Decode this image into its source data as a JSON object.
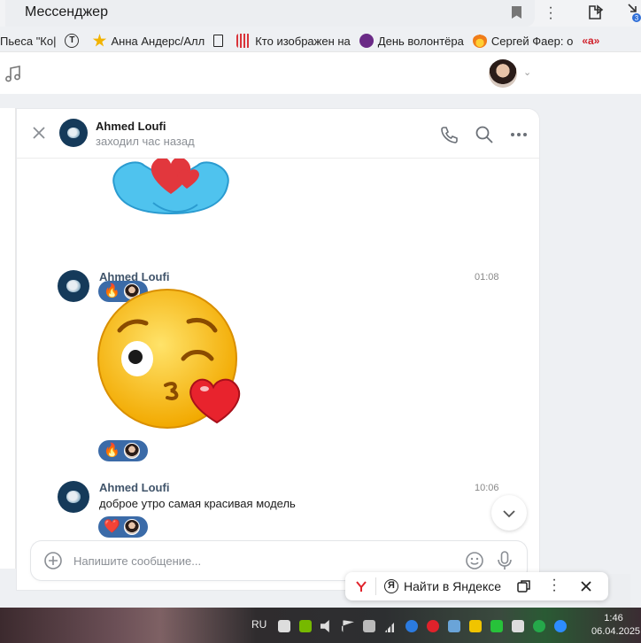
{
  "browser": {
    "tab_title": "Мессенджер",
    "bookmarks": [
      {
        "label": "Пьеса \"Ко|",
        "icon": "none"
      },
      {
        "label": "",
        "icon": "circle-t-icon"
      },
      {
        "label": "Анна Андерс/Алл",
        "icon": "star-icon"
      },
      {
        "label": "",
        "icon": "doc-icon"
      },
      {
        "label": "Кто изображен на",
        "icon": "sound-icon"
      },
      {
        "label": "День волонтёра",
        "icon": "ok-icon"
      },
      {
        "label": "Сергей Фаер: о",
        "icon": "flame-icon"
      },
      {
        "label": "«а»",
        "icon": "a-icon"
      }
    ],
    "download_badge": "3"
  },
  "chat": {
    "contact_name": "Ahmed Loufi",
    "contact_status": "заходил час назад",
    "messages": [
      {
        "sender": "",
        "time": "",
        "type": "sticker",
        "sticker": "hug-heart",
        "reaction": "🔥"
      },
      {
        "sender": "Ahmed Loufi",
        "time": "01:08",
        "type": "sticker",
        "sticker": "kiss-wink",
        "reaction": "🔥"
      },
      {
        "sender": "Ahmed Loufi",
        "time": "10:06",
        "type": "text",
        "text": "доброе утро самая красивая модель",
        "reaction": "❤️"
      }
    ],
    "composer_placeholder": "Напишите сообщение..."
  },
  "yandex_bar": {
    "find_label": "Найти в Яндексе"
  },
  "taskbar": {
    "lang": "RU",
    "time": "1:46",
    "date": "06.04.2025"
  },
  "colors": {
    "reaction_bg": "#3b6ba8",
    "avatar_bg": "#153a5a",
    "sender_color": "#40546a"
  }
}
